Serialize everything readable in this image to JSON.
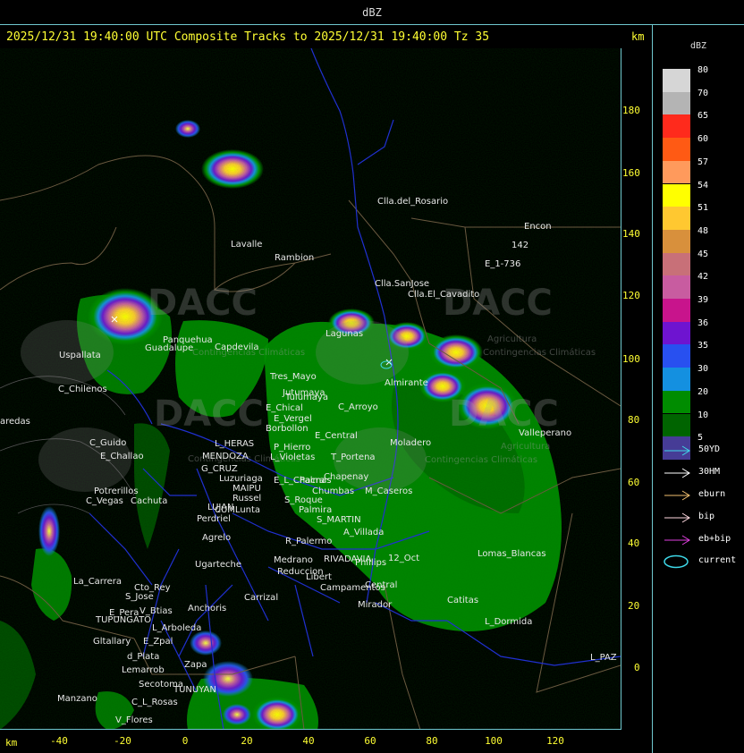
{
  "window": {
    "title": "dBZ"
  },
  "header": {
    "title": "2025/12/31 19:40:00 UTC Composite Tracks to 2025/12/31 19:40:00 Tz 35",
    "km_label": "km"
  },
  "axes": {
    "y_ticks": [
      "180",
      "160",
      "140",
      "120",
      "100",
      "80",
      "60",
      "40",
      "20",
      "0"
    ],
    "x_ticks": [
      "-40",
      "-20",
      "0",
      "20",
      "40",
      "60",
      "80",
      "100",
      "120"
    ],
    "km_label": "km"
  },
  "legend": {
    "title": "dBZ",
    "levels": [
      {
        "label": "80",
        "color": "#d6d6d6"
      },
      {
        "label": "70",
        "color": "#b4b4b4"
      },
      {
        "label": "65",
        "color": "#ff2a1c"
      },
      {
        "label": "60",
        "color": "#ff5a14"
      },
      {
        "label": "57",
        "color": "#ff9a5c"
      },
      {
        "label": "54",
        "color": "#ffff00"
      },
      {
        "label": "51",
        "color": "#ffc830"
      },
      {
        "label": "48",
        "color": "#d8903c"
      },
      {
        "label": "45",
        "color": "#c87078"
      },
      {
        "label": "42",
        "color": "#c85ca0"
      },
      {
        "label": "39",
        "color": "#c8148c"
      },
      {
        "label": "36",
        "color": "#6e14d0"
      },
      {
        "label": "35",
        "color": "#2850f0"
      },
      {
        "label": "30",
        "color": "#1490e0"
      },
      {
        "label": "20",
        "color": "#008c00"
      },
      {
        "label": "10",
        "color": "#006400"
      },
      {
        "label": "5",
        "color": "#463c96"
      }
    ],
    "tracks": [
      {
        "label": "50YD",
        "color": "#3ed8e8",
        "icon": "arrow-icon"
      },
      {
        "label": "30HM",
        "color": "#ffffff",
        "icon": "arrow-icon"
      },
      {
        "label": "eburn",
        "color": "#f2c070",
        "icon": "arrow-icon"
      },
      {
        "label": "bip",
        "color": "#ffd8e0",
        "icon": "arrow-icon"
      },
      {
        "label": "eb+bip",
        "color": "#e040e0",
        "icon": "arrow-icon"
      },
      {
        "label": "current",
        "color": "#3ed8e8",
        "icon": "ellipse-icon"
      }
    ]
  },
  "places": [
    {
      "name": "Clla.del_Rosario"
    },
    {
      "name": "Encon"
    },
    {
      "name": "142"
    },
    {
      "name": "E_1-736"
    },
    {
      "name": "Rambion"
    },
    {
      "name": "Clla.SanJose"
    },
    {
      "name": "Clla.El_Cavadito"
    },
    {
      "name": "Uspallata"
    },
    {
      "name": "C_Chilenos"
    },
    {
      "name": "aredas"
    },
    {
      "name": "C_Guido"
    },
    {
      "name": "E_Challao"
    },
    {
      "name": "L_HERAS"
    },
    {
      "name": "MENDOZA"
    },
    {
      "name": "G_CRUZ"
    },
    {
      "name": "Luzuriaga"
    },
    {
      "name": "MAIPU"
    },
    {
      "name": "Russel"
    },
    {
      "name": "LUJAN"
    },
    {
      "name": "CUMLunta"
    },
    {
      "name": "Potrerillos"
    },
    {
      "name": "C_Vegas"
    },
    {
      "name": "Cachuta"
    },
    {
      "name": "Perdriel"
    },
    {
      "name": "Agrelo"
    },
    {
      "name": "Ugarteche"
    },
    {
      "name": "La_Carrera"
    },
    {
      "name": "Cto_Rey"
    },
    {
      "name": "S_Jose"
    },
    {
      "name": "E_Pera"
    },
    {
      "name": "V_Btias"
    },
    {
      "name": "TUPUNGATO"
    },
    {
      "name": "Anchoris"
    },
    {
      "name": "L_Arboleda"
    },
    {
      "name": "Carrizal"
    },
    {
      "name": "Gltallary"
    },
    {
      "name": "E_Zpal"
    },
    {
      "name": "d_Plata"
    },
    {
      "name": "Zapa"
    },
    {
      "name": "Lemarrob"
    },
    {
      "name": "Secotoma"
    },
    {
      "name": "TUNUYAN"
    },
    {
      "name": "Manzano"
    },
    {
      "name": "C_L_Rosas"
    },
    {
      "name": "V_Flores"
    },
    {
      "name": "Tres_Mayo"
    },
    {
      "name": "Jutumaya"
    },
    {
      "name": "E_Chical"
    },
    {
      "name": "E_Vergel"
    },
    {
      "name": "Borbollon"
    },
    {
      "name": "P_Hierro"
    },
    {
      "name": "L_Violetas"
    },
    {
      "name": "C_Arroyo"
    },
    {
      "name": "E_Central"
    },
    {
      "name": "Moladero"
    },
    {
      "name": "T_Portena"
    },
    {
      "name": "Chapenay"
    },
    {
      "name": "E_L_Chacra"
    },
    {
      "name": "Palmas"
    },
    {
      "name": "Chumbas"
    },
    {
      "name": "M_Caseros"
    },
    {
      "name": "S_Roque"
    },
    {
      "name": "Palmira"
    },
    {
      "name": "S_MARTIN"
    },
    {
      "name": "A_Villada"
    },
    {
      "name": "R_Palermo"
    },
    {
      "name": "Medrano"
    },
    {
      "name": "Reduccion"
    },
    {
      "name": "RIVADAVIA"
    },
    {
      "name": "Phillips"
    },
    {
      "name": "12_Oct"
    },
    {
      "name": "Libert"
    },
    {
      "name": "Central"
    },
    {
      "name": "Campamentos"
    },
    {
      "name": "Lomas_Blancas"
    },
    {
      "name": "Catitas"
    },
    {
      "name": "Mirador"
    },
    {
      "name": "L_Dormida"
    },
    {
      "name": "L_PAZ"
    },
    {
      "name": "Lavalle"
    },
    {
      "name": "Panquehua"
    },
    {
      "name": "Guadalupe"
    },
    {
      "name": "Capdevila"
    },
    {
      "name": "Tulumaya"
    },
    {
      "name": "Lagunas"
    },
    {
      "name": "Almirante"
    },
    {
      "name": "Valleperano"
    }
  ],
  "watermark": {
    "brand": "DACC",
    "line1": "Agricultura",
    "line2": "Contingencias Climáticas"
  }
}
